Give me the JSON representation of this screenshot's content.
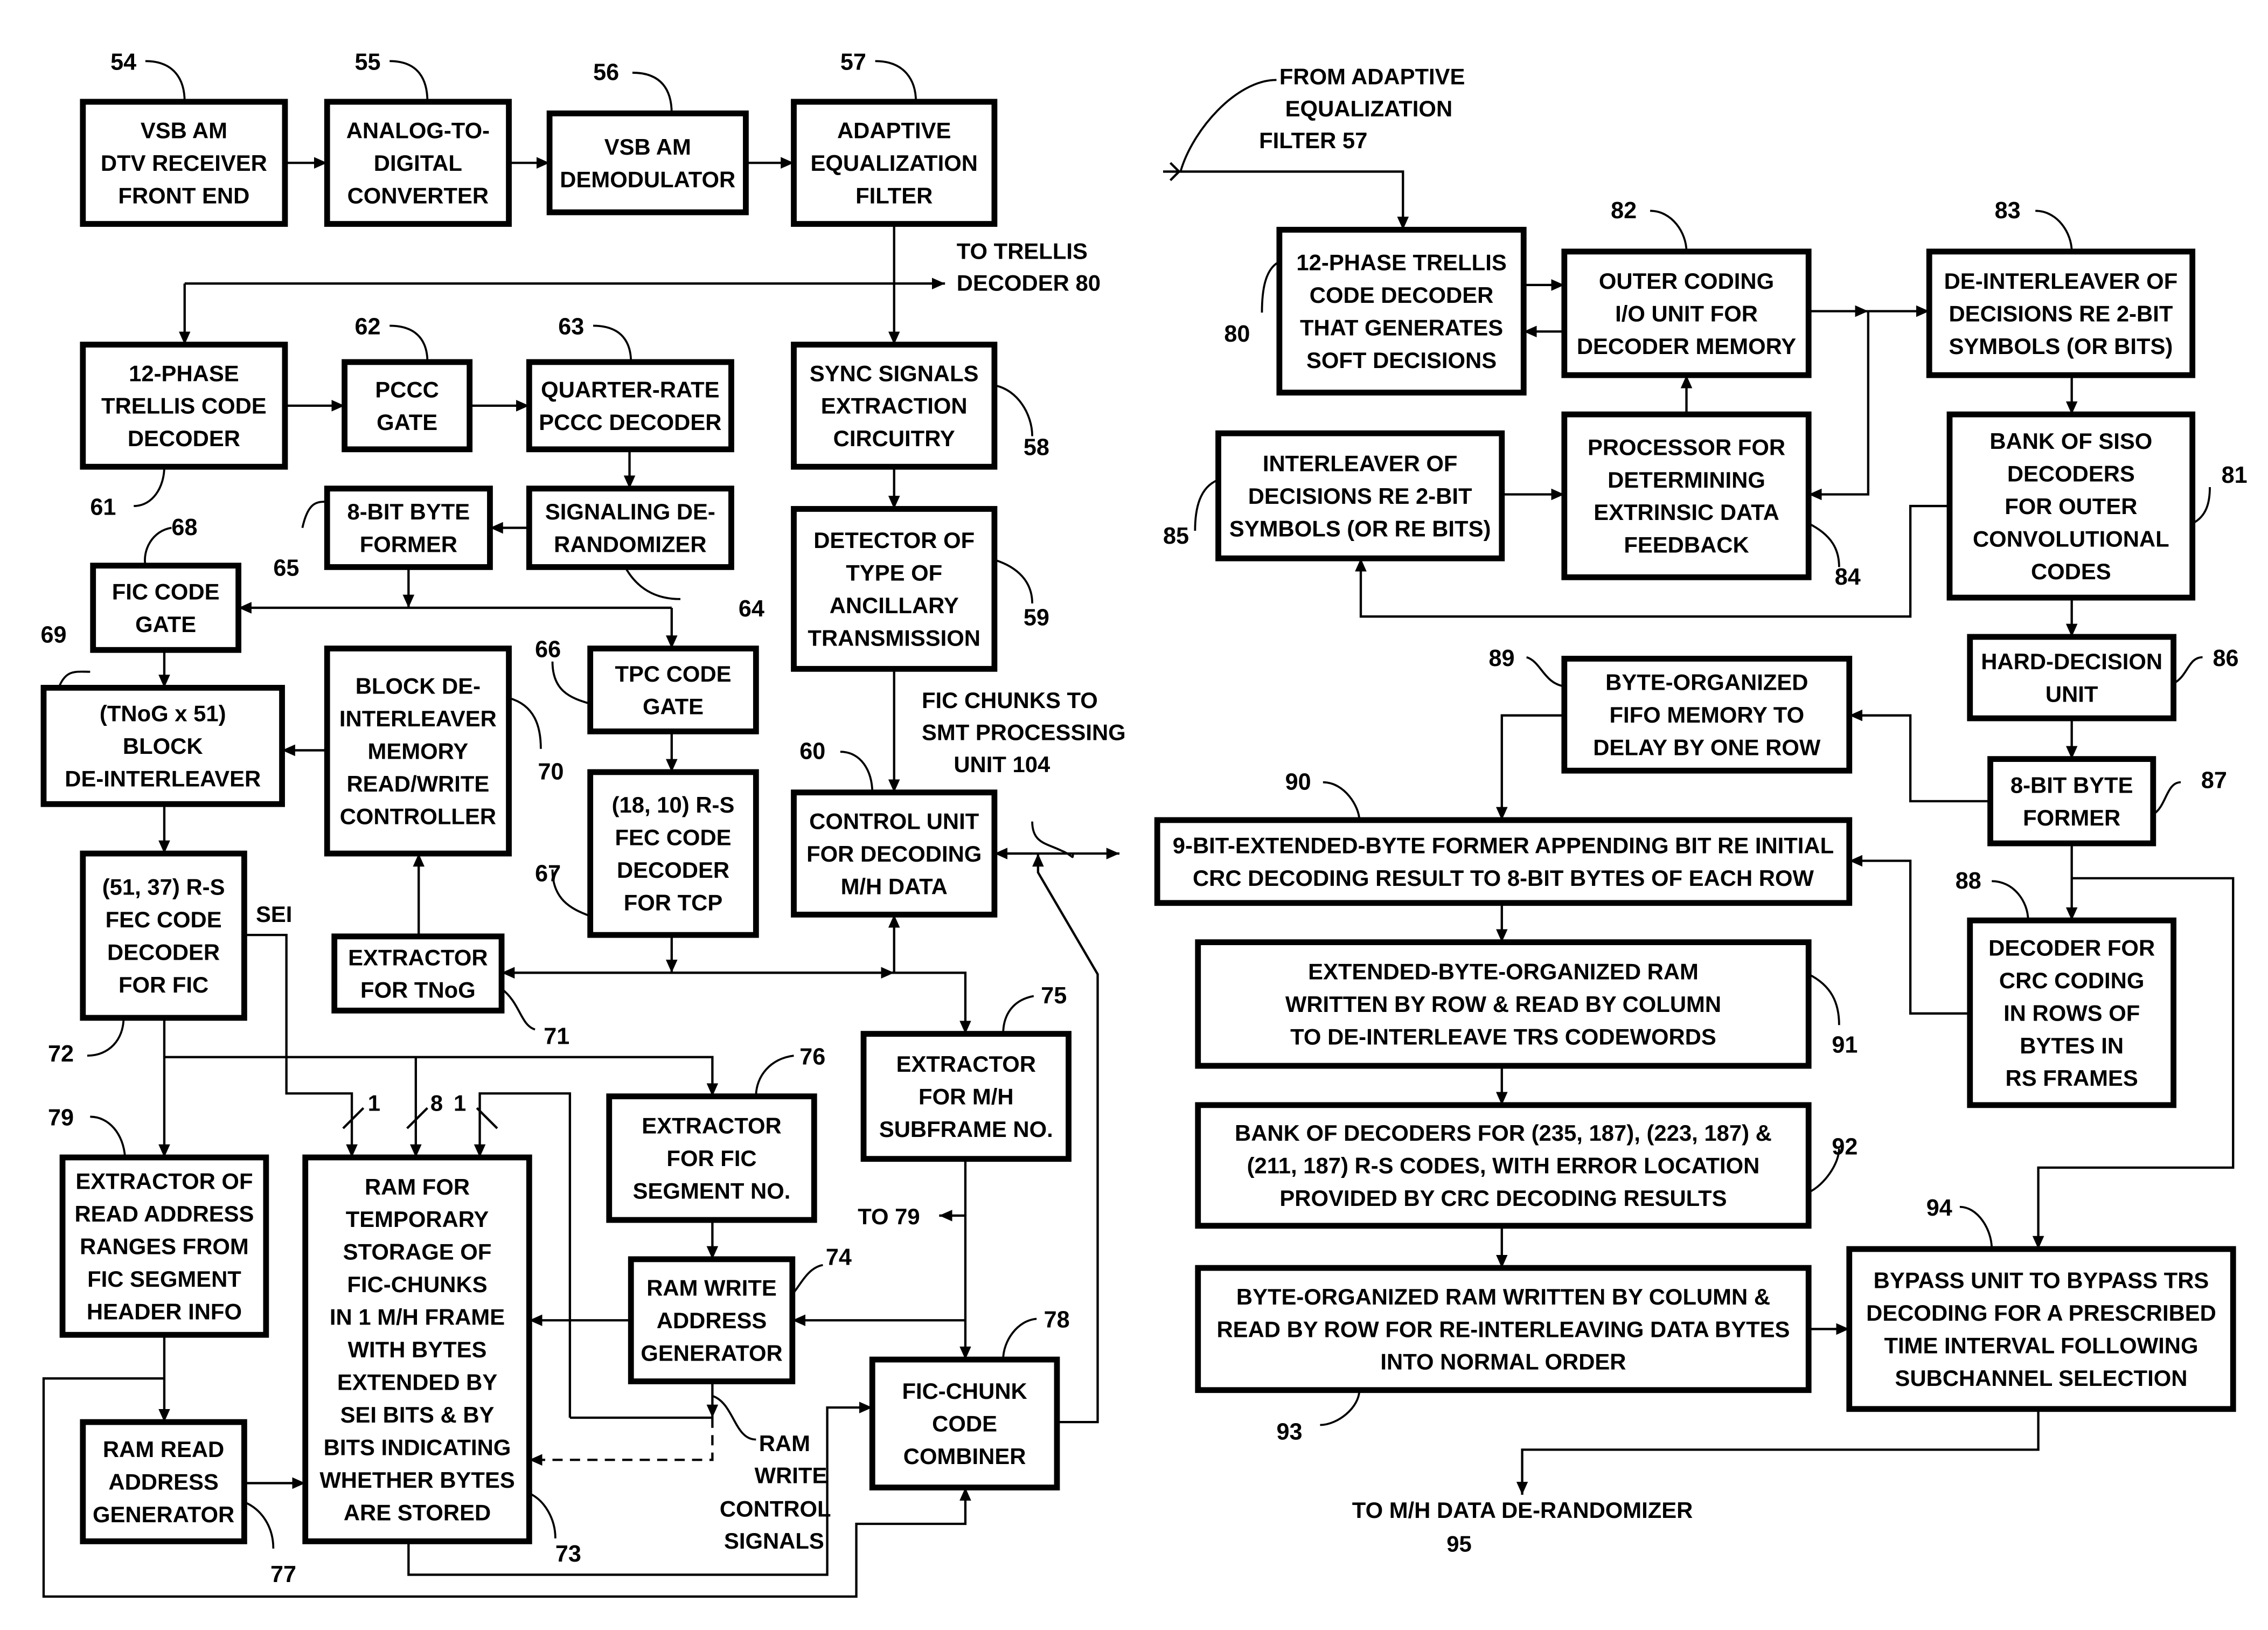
{
  "diagram": {
    "blocks": {
      "b54": {
        "ref": "54",
        "lines": [
          "VSB AM",
          "DTV RECEIVER",
          "FRONT  END"
        ]
      },
      "b55": {
        "ref": "55",
        "lines": [
          "ANALOG-TO-",
          "DIGITAL",
          "CONVERTER"
        ]
      },
      "b56": {
        "ref": "56",
        "lines": [
          "VSB AM",
          "DEMODULATOR"
        ]
      },
      "b57": {
        "ref": "57",
        "lines": [
          "ADAPTIVE",
          "EQUALIZATION",
          "FILTER"
        ]
      },
      "b61": {
        "ref": "61",
        "lines": [
          "12-PHASE",
          "TRELLIS CODE",
          "DECODER"
        ]
      },
      "b62": {
        "ref": "62",
        "lines": [
          "PCCC",
          "GATE"
        ]
      },
      "b63": {
        "ref": "63",
        "lines": [
          "QUARTER-RATE",
          "PCCC DECODER"
        ]
      },
      "b58": {
        "ref": "58",
        "lines": [
          "SYNC SIGNALS",
          "EXTRACTION",
          "CIRCUITRY"
        ]
      },
      "b65": {
        "ref": "65",
        "lines": [
          "8-BIT BYTE",
          "FORMER"
        ]
      },
      "b64": {
        "ref": "64",
        "lines": [
          "SIGNALING DE-",
          "RANDOMIZER"
        ]
      },
      "b59": {
        "ref": "59",
        "lines": [
          "DETECTOR OF",
          "TYPE OF",
          "ANCILLARY",
          "TRANSMISSION"
        ]
      },
      "b68": {
        "ref": "68",
        "lines": [
          "FIC CODE",
          "GATE"
        ]
      },
      "b69": {
        "ref": "69",
        "lines": [
          "(TNoG x 51)",
          "BLOCK",
          "DE-INTERLEAVER"
        ]
      },
      "b70": {
        "ref": "70",
        "lines": [
          "BLOCK DE-",
          "INTERLEAVER",
          "MEMORY",
          "READ/WRITE",
          "CONTROLLER"
        ]
      },
      "b66": {
        "ref": "66",
        "lines": [
          "TPC CODE",
          "GATE"
        ]
      },
      "b67": {
        "ref": "67",
        "lines": [
          "(18, 10) R-S",
          "FEC CODE",
          "DECODER",
          "FOR TCP"
        ]
      },
      "b60": {
        "ref": "60",
        "lines": [
          "CONTROL UNIT",
          "FOR DECODING",
          "M/H DATA"
        ]
      },
      "b72": {
        "ref": "72",
        "lines": [
          "(51, 37) R-S",
          "FEC CODE",
          "DECODER",
          "FOR FIC"
        ]
      },
      "b71": {
        "ref": "71",
        "lines": [
          "EXTRACTOR",
          "FOR TNoG"
        ]
      },
      "b75": {
        "ref": "75",
        "lines": [
          "EXTRACTOR",
          "FOR M/H",
          "SUBFRAME NO."
        ]
      },
      "b76": {
        "ref": "76",
        "lines": [
          "EXTRACTOR",
          "FOR  FIC",
          "SEGMENT NO."
        ]
      },
      "b79": {
        "ref": "79",
        "lines": [
          "EXTRACTOR OF",
          "READ ADDRESS",
          "RANGES FROM",
          "FIC SEGMENT",
          "HEADER INFO"
        ]
      },
      "b73": {
        "ref": "73",
        "lines": [
          "RAM FOR",
          "TEMPORARY",
          "STORAGE OF",
          "FIC-CHUNKS",
          "IN 1 M/H FRAME",
          "WITH BYTES",
          "EXTENDED BY",
          "SEI BITS & BY",
          "BITS INDICATING",
          "WHETHER BYTES",
          "ARE STORED"
        ]
      },
      "b74": {
        "ref": "74",
        "lines": [
          "RAM WRITE",
          "ADDRESS",
          "GENERATOR"
        ]
      },
      "b78": {
        "ref": "78",
        "lines": [
          "FIC-CHUNK",
          "CODE",
          "COMBINER"
        ]
      },
      "b77": {
        "ref": "77",
        "lines": [
          "RAM READ",
          "ADDRESS",
          "GENERATOR"
        ]
      },
      "b80": {
        "ref": "80",
        "lines": [
          "12-PHASE TRELLIS",
          "CODE DECODER",
          "THAT GENERATES",
          "SOFT DECISIONS"
        ]
      },
      "b82": {
        "ref": "82",
        "lines": [
          "OUTER CODING",
          "I/O UNIT  FOR",
          "DECODER MEMORY"
        ]
      },
      "b83": {
        "ref": "83",
        "lines": [
          "DE-INTERLEAVER OF",
          "DECISIONS RE 2-BIT",
          "SYMBOLS (OR BITS)"
        ]
      },
      "b85": {
        "ref": "85",
        "lines": [
          "INTERLEAVER OF",
          "DECISIONS RE 2-BIT",
          "SYMBOLS (OR RE BITS)"
        ]
      },
      "b84": {
        "ref": "84",
        "lines": [
          "PROCESSOR FOR",
          "DETERMINING",
          "EXTRINSIC DATA",
          "FEEDBACK"
        ]
      },
      "b81": {
        "ref": "81",
        "lines": [
          "BANK OF SISO",
          "DECODERS",
          "FOR OUTER",
          "CONVOLUTIONAL",
          "CODES"
        ]
      },
      "b86": {
        "ref": "86",
        "lines": [
          "HARD-DECISION",
          "UNIT"
        ]
      },
      "b89": {
        "ref": "89",
        "lines": [
          "BYTE-ORGANIZED",
          "FIFO MEMORY TO",
          "DELAY BY ONE ROW"
        ]
      },
      "b87": {
        "ref": "87",
        "lines": [
          "8-BIT BYTE",
          "FORMER"
        ]
      },
      "b90": {
        "ref": "90",
        "lines": [
          "9-BIT-EXTENDED-BYTE FORMER APPENDING BIT RE INITIAL",
          "CRC DECODING RESULT TO 8-BIT BYTES OF EACH ROW"
        ]
      },
      "b88": {
        "ref": "88",
        "lines": [
          "DECODER FOR",
          "CRC CODING",
          "IN ROWS OF",
          "BYTES IN",
          "RS FRAMES"
        ]
      },
      "b91": {
        "ref": "91",
        "lines": [
          "EXTENDED-BYTE-ORGANIZED RAM",
          "WRITTEN BY ROW & READ BY COLUMN",
          "TO DE-INTERLEAVE TRS CODEWORDS"
        ]
      },
      "b92": {
        "ref": "92",
        "lines": [
          "BANK OF DECODERS FOR (235, 187), (223, 187) &",
          "(211, 187) R-S CODES, WITH ERROR LOCATION",
          "PROVIDED BY CRC DECODING RESULTS"
        ]
      },
      "b93": {
        "ref": "93",
        "lines": [
          "BYTE-ORGANIZED RAM WRITTEN BY COLUMN &",
          "READ BY ROW FOR RE-INTERLEAVING DATA BYTES",
          "INTO NORMAL ORDER"
        ]
      },
      "b94": {
        "ref": "94",
        "lines": [
          "BYPASS UNIT TO BYPASS TRS",
          "DECODING FOR A PRESCRIBED",
          "TIME INTERVAL FOLLOWING",
          "SUBCHANNEL SELECTION"
        ]
      }
    },
    "labels": {
      "to_trellis": [
        "TO TRELLIS",
        "DECODER 80"
      ],
      "fic_chunks": [
        "FIC CHUNKS TO",
        "SMT PROCESSING",
        "UNIT 104"
      ],
      "sei": "SEI",
      "bus_1a": "1",
      "bus_8": "8",
      "bus_1b": "1",
      "to_79": "TO 79",
      "ram_write_ctrl": [
        "RAM",
        "WRITE",
        "CONTROL",
        "SIGNALS"
      ],
      "from_adaptive": [
        "FROM ADAPTIVE",
        "EQUALIZATION",
        "FILTER 57"
      ],
      "to_derandomizer": [
        "TO M/H DATA DE-RANDOMIZER",
        "95"
      ]
    }
  }
}
